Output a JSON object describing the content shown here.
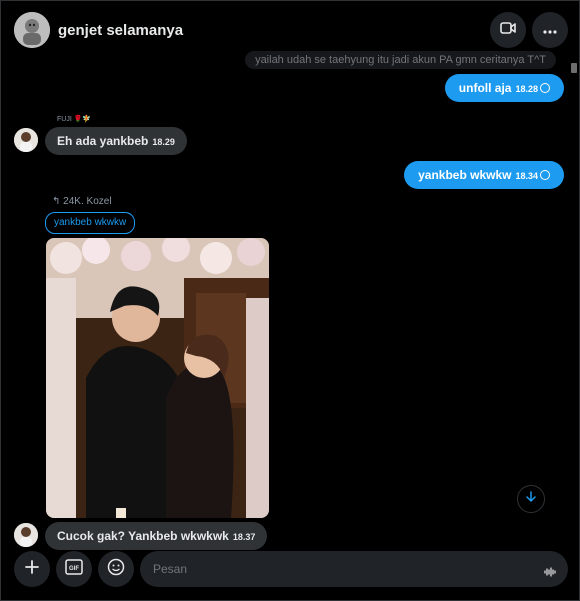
{
  "header": {
    "title": "genjet selamanya",
    "video_icon": "video-camera-icon",
    "more_icon": "more-horizontal-icon"
  },
  "messages": {
    "quoted_reply": "yailah udah se taehyung itu jadi akun PA gmn ceritanya T^T",
    "msg1": {
      "text": "unfoll aja",
      "time": "18.28"
    },
    "sender_fuji": "FUJI 🌹🧚",
    "msg2": {
      "text": "Eh ada yankbeb",
      "time": "18.29"
    },
    "msg3": {
      "text": "yankbeb wkwkw",
      "time": "18.34"
    },
    "reply_meta": "24K. Kozel",
    "reply_chip": "yankbeb wkwkw",
    "msg4": {
      "text": "Cucok gak? Yankbeb wkwkwk",
      "time": "18.37"
    }
  },
  "composer": {
    "placeholder": "Pesan",
    "gif_label": "GIF"
  },
  "colors": {
    "accent": "#1d9bf0",
    "bubble_in": "#2f3336",
    "background": "#000000"
  }
}
